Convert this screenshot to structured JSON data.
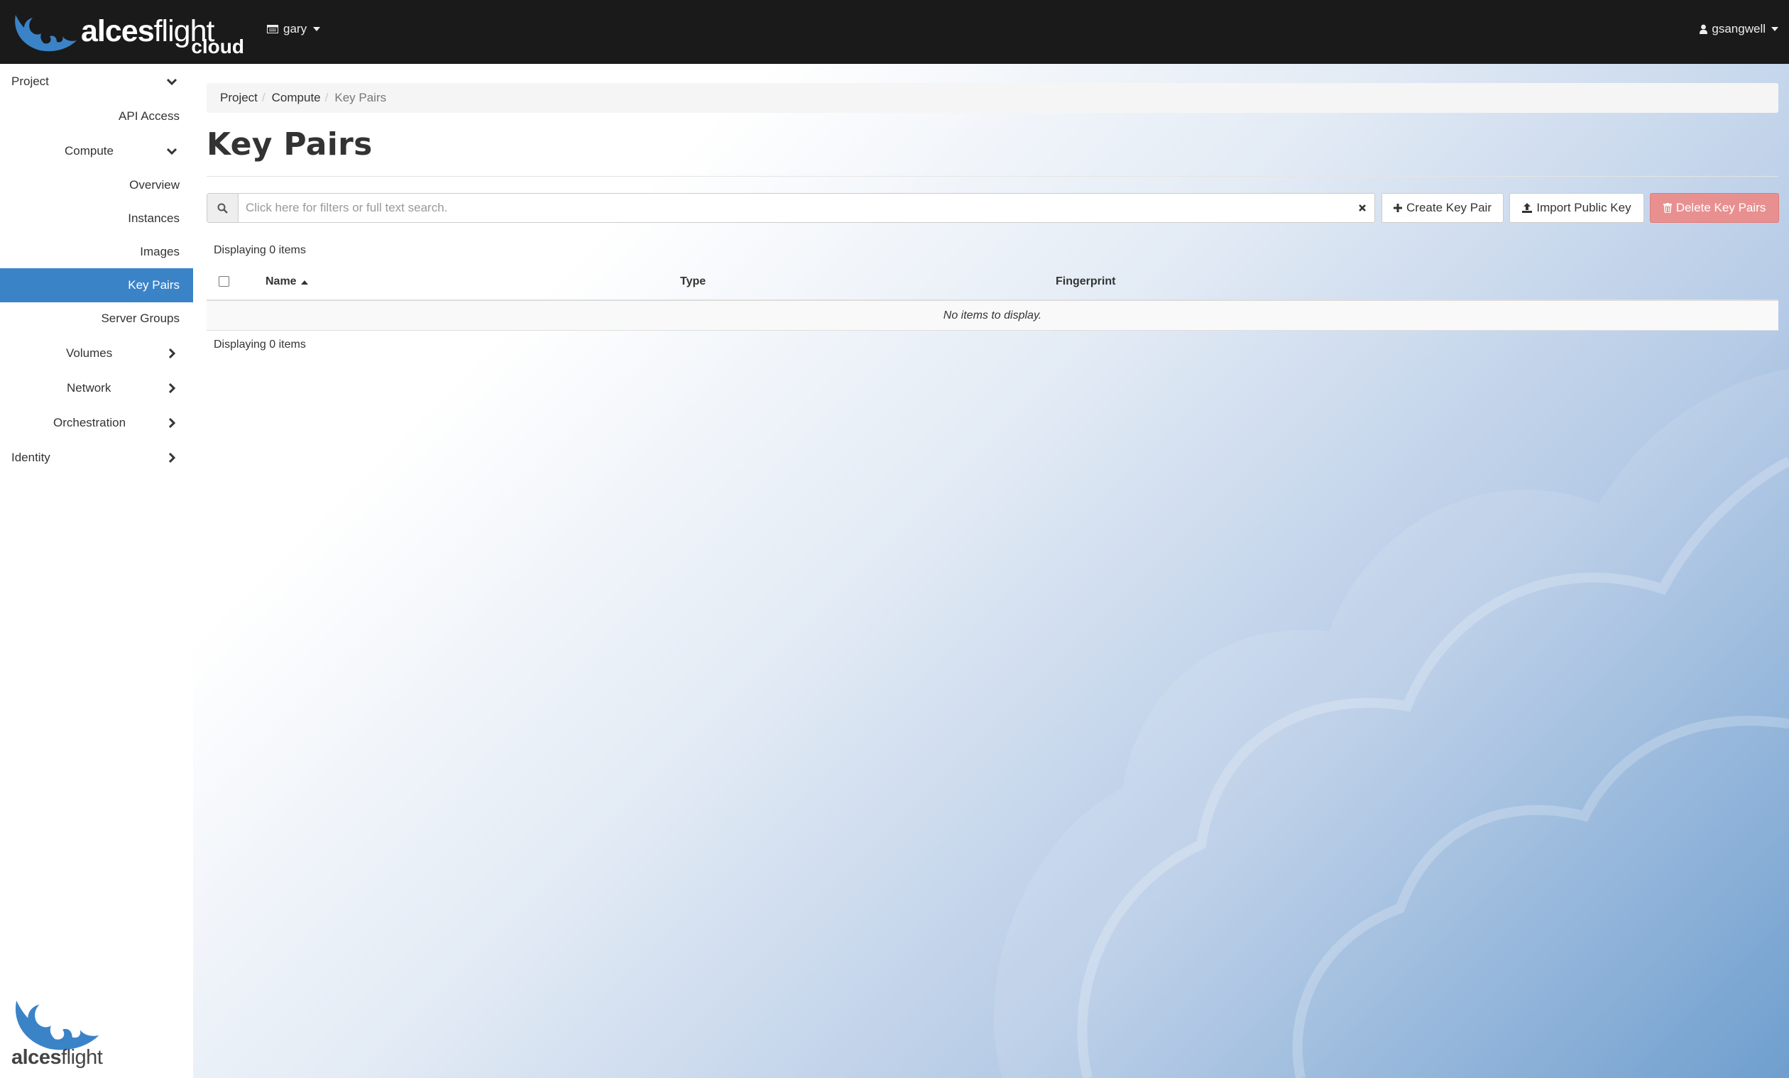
{
  "brand": {
    "name_bold": "alces",
    "name_light": "flight",
    "sub": "cloud",
    "accent_color": "#3b83c7"
  },
  "header": {
    "project_icon": "window-icon",
    "project_label": "gary",
    "user_icon": "user-icon",
    "user_label": "gsangwell"
  },
  "sidebar": {
    "items": [
      {
        "label": "Project",
        "chevron": "down"
      },
      {
        "label": "API Access"
      },
      {
        "label": "Compute",
        "chevron": "down"
      },
      {
        "label": "Overview"
      },
      {
        "label": "Instances"
      },
      {
        "label": "Images"
      },
      {
        "label": "Key Pairs",
        "active": true
      },
      {
        "label": "Server Groups"
      },
      {
        "label": "Volumes",
        "chevron": "right"
      },
      {
        "label": "Network",
        "chevron": "right"
      },
      {
        "label": "Orchestration",
        "chevron": "right"
      },
      {
        "label": "Identity",
        "chevron": "right"
      }
    ],
    "footer_logo": {
      "name_bold": "alces",
      "name_light": "flight"
    }
  },
  "breadcrumb": [
    "Project",
    "Compute",
    "Key Pairs"
  ],
  "page": {
    "title": "Key Pairs"
  },
  "toolbar": {
    "search_placeholder": "Click here for filters or full text search.",
    "search_value": "",
    "create_label": "Create Key Pair",
    "import_label": "Import Public Key",
    "delete_label": "Delete Key Pairs"
  },
  "table": {
    "count_text": "Displaying 0 items",
    "columns": [
      "Name",
      "Type",
      "Fingerprint"
    ],
    "sort_column": "Name",
    "sort_direction": "ascending",
    "rows": [],
    "empty_text": "No items to display."
  }
}
